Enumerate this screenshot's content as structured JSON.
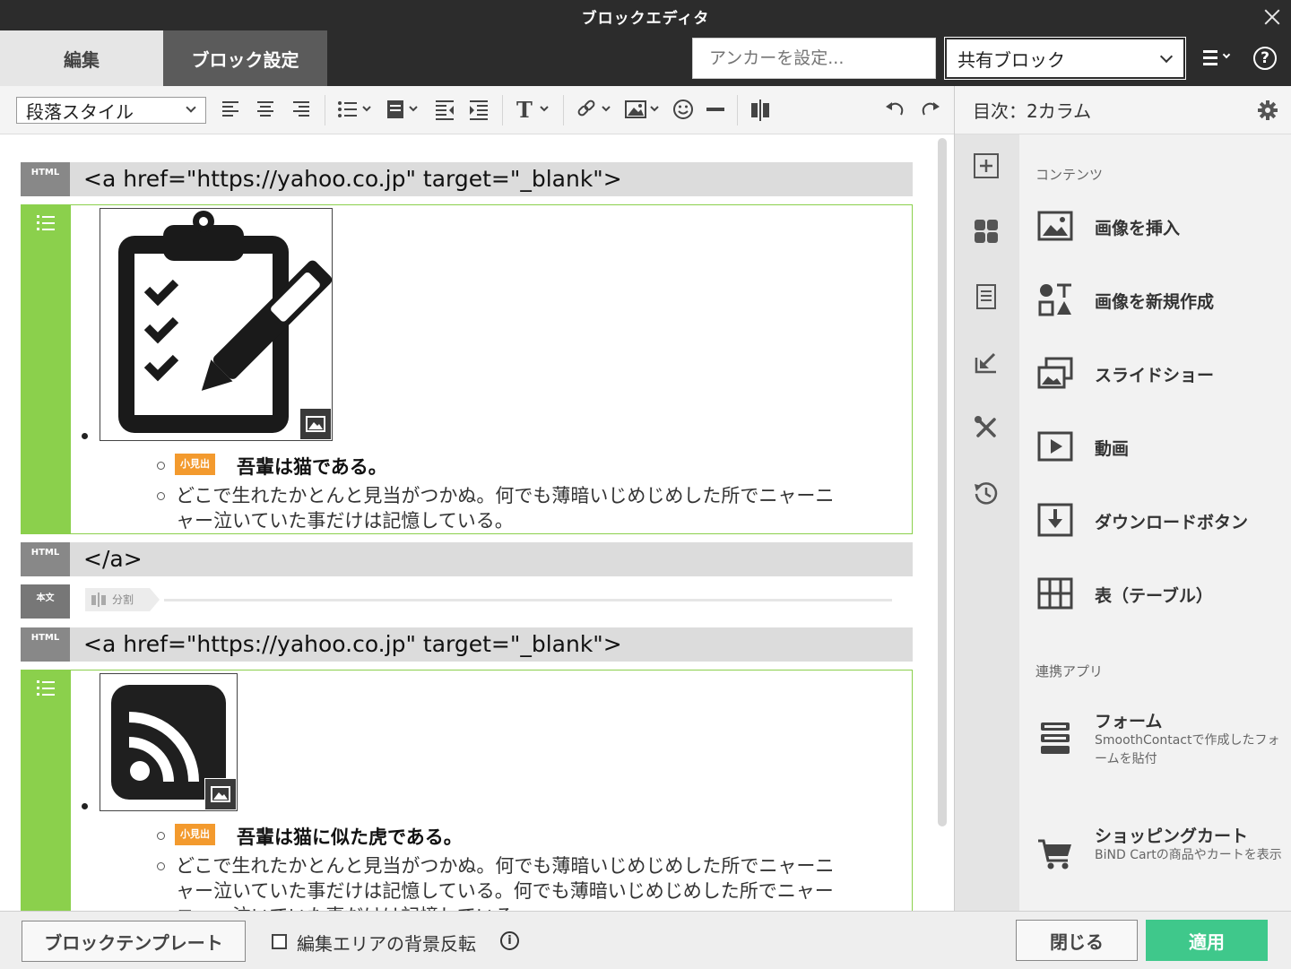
{
  "window": {
    "title": "ブロックエディタ"
  },
  "header": {
    "tabs": [
      {
        "label": "編集",
        "active": false
      },
      {
        "label": "ブロック設定",
        "active": true
      }
    ],
    "anchor_placeholder": "アンカーを設定...",
    "shared_block": "共有ブロック"
  },
  "toolbar": {
    "paragraph_style": "段落スタイル"
  },
  "editor": {
    "html_tag_label": "HTML",
    "text_tag_label": "本文",
    "split_label": "分割",
    "rows": {
      "open1": "<a href=\"https://yahoo.co.jp\" target=\"_blank\">",
      "close1": "</a>",
      "open2": "<a href=\"https://yahoo.co.jp\" target=\"_blank\">"
    },
    "blocks": [
      {
        "image_icon": "clipboard-checklist-icon",
        "badge": "小見出",
        "heading": "吾輩は猫である。",
        "body_line1": "どこで生れたかとんと見当がつかぬ。何でも薄暗いじめじめした所でニャーニ",
        "body_line2": "ャー泣いていた事だけは記憶している。"
      },
      {
        "image_icon": "rss-feed-icon",
        "badge": "小見出",
        "heading": "吾輩は猫に似た虎である。",
        "body_line1": "どこで生れたかとんと見当がつかぬ。何でも薄暗いじめじめした所でニャーニ",
        "body_line2": "ャー泣いていた事だけは記憶している。何でも薄暗いじめじめした所でニャー",
        "body_line3": "ニャー泣いていた事だけは記憶している。"
      }
    ]
  },
  "panel": {
    "title": "目次：2カラム",
    "contents_label": "コンテンツ",
    "items": [
      {
        "label": "画像を挿入"
      },
      {
        "label": "画像を新規作成"
      },
      {
        "label": "スライドショー"
      },
      {
        "label": "動画"
      },
      {
        "label": "ダウンロードボタン"
      },
      {
        "label": "表（テーブル）"
      }
    ],
    "apps_label": "連携アプリ",
    "apps": [
      {
        "label": "フォーム",
        "desc": "SmoothContactで作成したフォームを貼付"
      },
      {
        "label": "ショッピングカート",
        "desc": "BiND Cartの商品やカートを表示"
      }
    ]
  },
  "footer": {
    "template_button": "ブロックテンプレート",
    "invert_label": "編集エリアの背景反転",
    "invert_checked": false,
    "close_button": "閉じる",
    "apply_button": "適用"
  },
  "colors": {
    "titlebar": "#2c2c2c",
    "block_accent": "#8bd04c",
    "badge": "#f39a2e",
    "apply": "#3fc88b"
  }
}
